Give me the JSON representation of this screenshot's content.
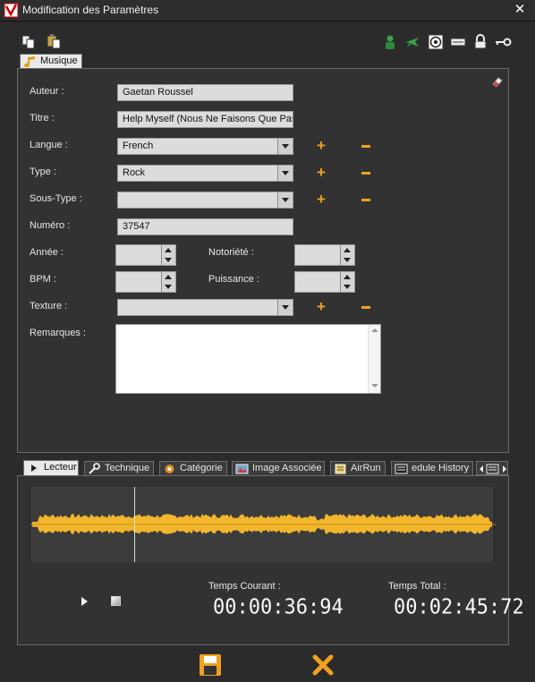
{
  "window": {
    "title": "Modification des Paramètres"
  },
  "icons": {
    "toolbar_left": [
      "copy-icon",
      "paste-icon"
    ],
    "toolbar_right": [
      "user-icon",
      "plane-icon",
      "target-icon",
      "keyboard-icon",
      "lock-icon",
      "key-icon"
    ]
  },
  "main_tab": {
    "label": "Musique"
  },
  "form": {
    "auteur_label": "Auteur :",
    "auteur_value": "Gaetan Roussel",
    "titre_label": "Titre :",
    "titre_value": "Help Myself (Nous Ne Faisons Que Pas",
    "langue_label": "Langue :",
    "langue_value": "French",
    "type_label": "Type :",
    "type_value": "Rock",
    "soustype_label": "Sous-Type :",
    "soustype_value": "",
    "numero_label": "Numéro :",
    "numero_value": "37547",
    "annee_label": "Année :",
    "notoriete_label": "Notoriété :",
    "bpm_label": "BPM :",
    "puissance_label": "Puissance :",
    "texture_label": "Texture :",
    "texture_value": "",
    "remarques_label": "Remarques :"
  },
  "lower_tabs": [
    {
      "label": "Lecteur"
    },
    {
      "label": "Technique"
    },
    {
      "label": "Catégorie"
    },
    {
      "label": "Image Associée"
    },
    {
      "label": "AirRun"
    },
    {
      "label": "edule History"
    }
  ],
  "player": {
    "temps_courant_label": "Temps Courant :",
    "temps_courant_value": "00:00:36:94",
    "temps_total_label": "Temps Total :",
    "temps_total_value": "00:02:45:72",
    "playhead_fraction": 0.224
  },
  "colors": {
    "accent": "#f0a020",
    "waveform": "#f2b62c",
    "panel": "#323232"
  }
}
